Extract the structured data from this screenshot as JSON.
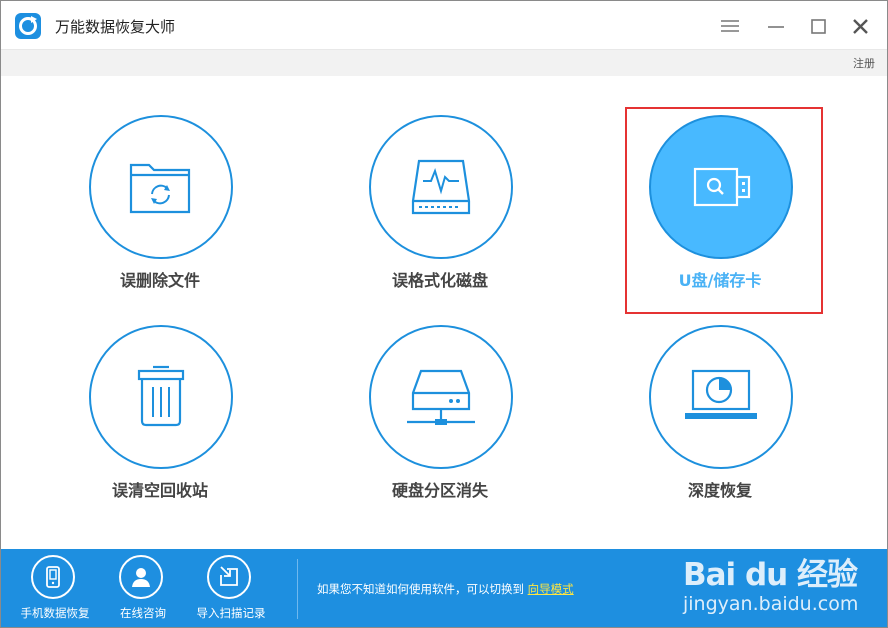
{
  "window": {
    "title": "万能数据恢复大师"
  },
  "subbar": {
    "register_label": "注册"
  },
  "tiles": [
    {
      "label": "误删除文件",
      "icon": "folder-recycle-icon"
    },
    {
      "label": "误格式化磁盘",
      "icon": "disk-pulse-icon"
    },
    {
      "label": "U盘/储存卡",
      "icon": "usb-drive-icon",
      "selected": true
    },
    {
      "label": "误清空回收站",
      "icon": "trash-bin-icon"
    },
    {
      "label": "硬盘分区消失",
      "icon": "network-drive-icon"
    },
    {
      "label": "深度恢复",
      "icon": "laptop-scan-icon"
    }
  ],
  "bottom": {
    "buttons": [
      {
        "label": "手机数据恢复",
        "icon": "phone-icon"
      },
      {
        "label": "在线咨询",
        "icon": "person-icon"
      },
      {
        "label": "导入扫描记录",
        "icon": "import-icon"
      }
    ],
    "hint_text": "如果您不知道如何使用软件，可以切换到",
    "hint_link": "向导模式"
  },
  "watermark": {
    "logo_text": "Bai du 经验",
    "url": "jingyan.baidu.com"
  },
  "colors": {
    "accent": "#1e8fe0",
    "selected_fill": "#48b9ff",
    "selected_label": "#4ab2f5",
    "highlight_frame": "#e53333",
    "link": "#ffe640"
  }
}
